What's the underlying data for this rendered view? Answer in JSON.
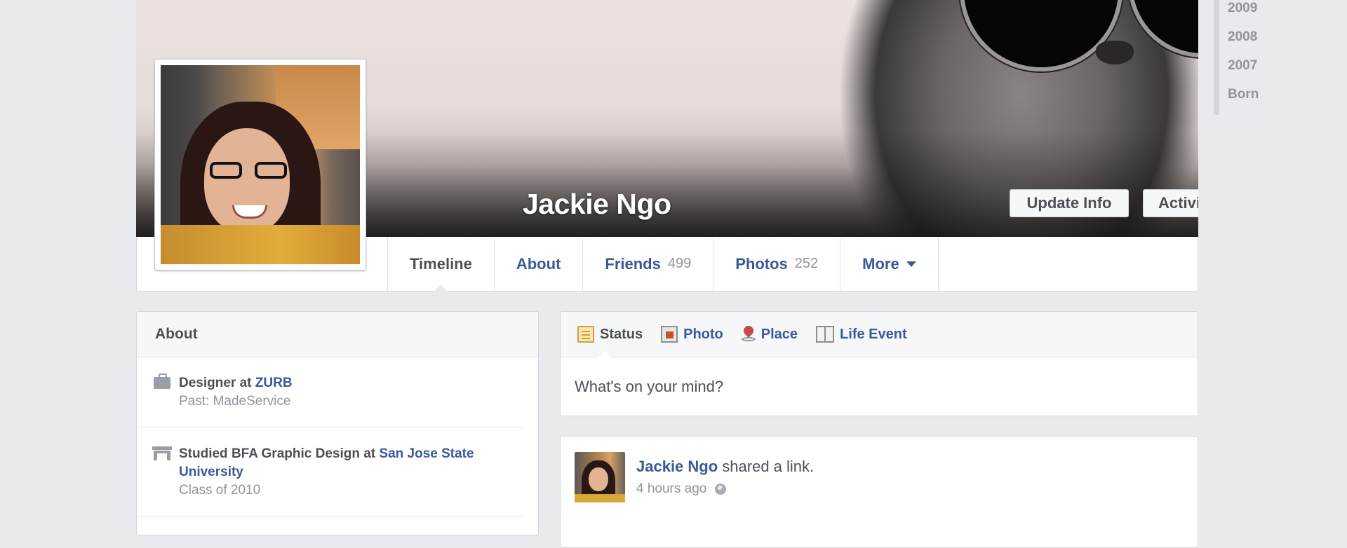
{
  "profile": {
    "name": "Jackie Ngo"
  },
  "cover": {
    "buttons": {
      "update_info": "Update Info",
      "activity_log": "Activity Log",
      "settings_glyph": "✲"
    }
  },
  "tabs": [
    {
      "label": "Timeline",
      "count": ""
    },
    {
      "label": "About",
      "count": ""
    },
    {
      "label": "Friends",
      "count": "499"
    },
    {
      "label": "Photos",
      "count": "252"
    },
    {
      "label": "More",
      "count": ""
    }
  ],
  "year_nav": [
    "2009",
    "2008",
    "2007",
    "Born"
  ],
  "about": {
    "title": "About",
    "work": {
      "prefix": "Designer at ",
      "company": "ZURB",
      "past": "Past: MadeService"
    },
    "education": {
      "prefix": "Studied BFA Graphic Design at ",
      "school": "San Jose State University",
      "class": "Class of 2010"
    }
  },
  "composer": {
    "tabs": [
      "Status",
      "Photo",
      "Place",
      "Life Event"
    ],
    "placeholder": "What's on your mind?"
  },
  "post": {
    "author": "Jackie Ngo",
    "action": " shared a link.",
    "time": "4 hours ago"
  },
  "colors": {
    "link": "#3b5998",
    "page_bg": "#e9eaed"
  },
  "icons": {
    "settings": "gear-icon",
    "audience": "globe-icon",
    "work": "briefcase-icon",
    "education": "school-icon"
  }
}
